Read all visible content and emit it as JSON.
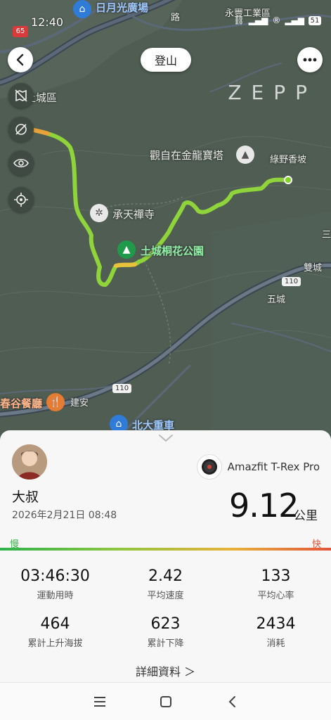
{
  "status_bar": {
    "time": "12:40",
    "route_badge": "65",
    "battery": "51",
    "right_icons": [
      "link-icon",
      "signal-icon",
      "registered-icon",
      "signal-icon"
    ]
  },
  "header": {
    "activity_type": "登山",
    "brand": "ZEPP"
  },
  "map": {
    "labels": {
      "sunmoon_plaza": "日月光廣場",
      "yongfeng": "永豐工業區",
      "tucheng_district": "土城區",
      "guanzizai": "觀自在金龍寶塔",
      "lvye": "綠野香坡",
      "chengtian": "承天禪寺",
      "tungflower_park": "土城桐花公園",
      "shuangcheng": "雙城",
      "wucheng": "五城",
      "restaurant": "春谷餐廳",
      "jianan": "建安",
      "beida": "北大重車",
      "road_110_a": "110",
      "road_110_b": "110",
      "road_right": "三",
      "road_top": "路"
    },
    "colors": {
      "track_start": "#e8a23a",
      "track_main": "#7ed321",
      "track_slow": "#a8e048"
    }
  },
  "summary": {
    "user_name": "大叔",
    "datetime": "2026年2月21日 08:48",
    "device_name": "Amazfit T-Rex Pro",
    "distance": "9.12",
    "distance_unit": "公里",
    "speed_slow_label": "慢",
    "speed_fast_label": "快",
    "stats": [
      {
        "value": "03:46:30",
        "label": "運動用時"
      },
      {
        "value": "2.42",
        "label": "平均速度"
      },
      {
        "value": "133",
        "label": "平均心率"
      },
      {
        "value": "464",
        "label": "累計上升海拔"
      },
      {
        "value": "623",
        "label": "累計下降"
      },
      {
        "value": "2434",
        "label": "消耗"
      }
    ],
    "details_label": "詳細資料 ＞"
  }
}
